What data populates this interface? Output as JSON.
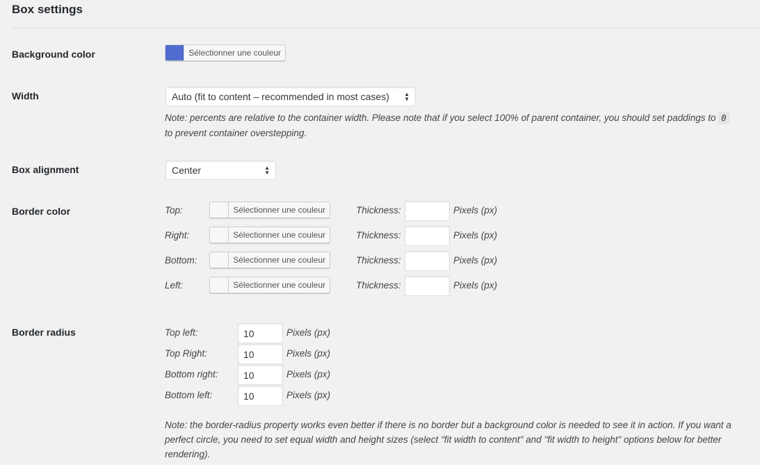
{
  "title": "Box settings",
  "background": {
    "label": "Background color",
    "button_label": "Sélectionner une couleur",
    "swatch_color": "#4f6bce"
  },
  "width": {
    "label": "Width",
    "selected": "Auto (fit to content – recommended in most cases)",
    "note_before": "Note: percents are relative to the container width. Please note that if you select 100% of parent container, you should set paddings to",
    "note_code": "0",
    "note_after": "to prevent container overstepping."
  },
  "alignment": {
    "label": "Box alignment",
    "selected": "Center"
  },
  "border_color": {
    "label": "Border color",
    "button_label": "Sélectionner une couleur",
    "thickness_label": "Thickness:",
    "unit_label": "Pixels (px)",
    "rows": [
      {
        "side": "Top:",
        "thickness": ""
      },
      {
        "side": "Right:",
        "thickness": ""
      },
      {
        "side": "Bottom:",
        "thickness": ""
      },
      {
        "side": "Left:",
        "thickness": ""
      }
    ]
  },
  "border_radius": {
    "label": "Border radius",
    "unit_label": "Pixels (px)",
    "rows": [
      {
        "corner": "Top left:",
        "value": "10"
      },
      {
        "corner": "Top Right:",
        "value": "10"
      },
      {
        "corner": "Bottom right:",
        "value": "10"
      },
      {
        "corner": "Bottom left:",
        "value": "10"
      }
    ],
    "note_line1": "Note: the border-radius property works even better if there is no border but a background color is needed to see it in action. If you want a",
    "note_line2": "perfect circle, you need to set equal width and height sizes (select \"fit width to content\" and \"fit width to height\" options below for better",
    "note_line3": "rendering)."
  }
}
